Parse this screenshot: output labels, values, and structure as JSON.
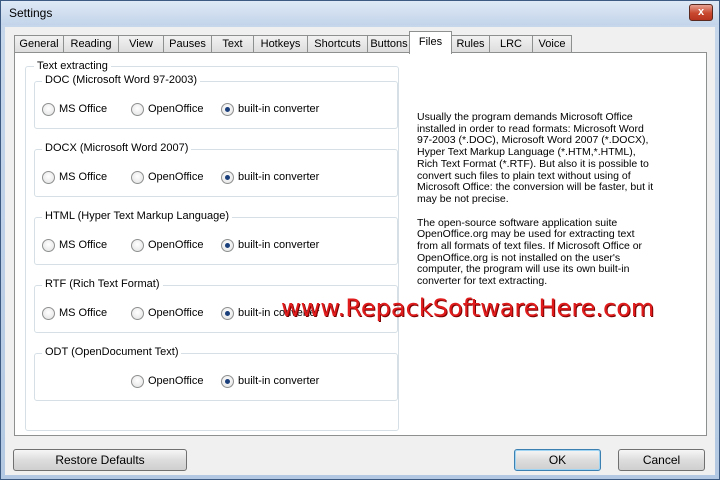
{
  "window": {
    "title": "Settings",
    "close_glyph": "x"
  },
  "tabs": [
    {
      "label": "General"
    },
    {
      "label": "Reading"
    },
    {
      "label": "View"
    },
    {
      "label": "Pauses"
    },
    {
      "label": "Text"
    },
    {
      "label": "Hotkeys"
    },
    {
      "label": "Shortcuts"
    },
    {
      "label": "Buttons"
    },
    {
      "label": "Files",
      "active": true
    },
    {
      "label": "Rules"
    },
    {
      "label": "LRC"
    },
    {
      "label": "Voice"
    }
  ],
  "text_extracting": {
    "title": "Text extracting",
    "groups": [
      {
        "title": "DOC (Microsoft Word 97-2003)",
        "opt_ms": "MS Office",
        "opt_oo": "OpenOffice",
        "opt_builtin": "built-in converter",
        "selected": "builtin"
      },
      {
        "title": "DOCX (Microsoft Word 2007)",
        "opt_ms": "MS Office",
        "opt_oo": "OpenOffice",
        "opt_builtin": "built-in converter",
        "selected": "builtin"
      },
      {
        "title": "HTML (Hyper Text Markup Language)",
        "opt_ms": "MS Office",
        "opt_oo": "OpenOffice",
        "opt_builtin": "built-in converter",
        "selected": "builtin"
      },
      {
        "title": "RTF (Rich Text Format)",
        "opt_ms": "MS Office",
        "opt_oo": "OpenOffice",
        "opt_builtin": "built-in converter",
        "selected": "builtin"
      },
      {
        "title": "ODT (OpenDocument Text)",
        "opt_oo": "OpenOffice",
        "opt_builtin": "built-in converter",
        "selected": "builtin"
      }
    ]
  },
  "description": {
    "p1": "Usually the program demands Microsoft Office installed in order to read formats: Microsoft Word 97-2003 (*.DOC), Microsoft Word 2007 (*.DOCX), Hyper Text Markup Language (*.HTM,*.HTML), Rich Text Format (*.RTF). But also it is possible to convert such files to plain text without using of Microsoft Office: the conversion will be faster, but it may be not precise.",
    "p2": "The open-source software application suite OpenOffice.org may be used for extracting text from all formats of text files. If Microsoft Office or OpenOffice.org is not installed on the user's computer, the program will use its own built-in converter for text extracting."
  },
  "watermark": "www.RepackSoftwareHere.com",
  "buttons": {
    "restore": "Restore Defaults",
    "ok": "OK",
    "cancel": "Cancel"
  },
  "colors": {
    "watermark": "#e01c1c",
    "radio_dot": "#1a3f7a",
    "titlebar": "#c3d4ea"
  }
}
